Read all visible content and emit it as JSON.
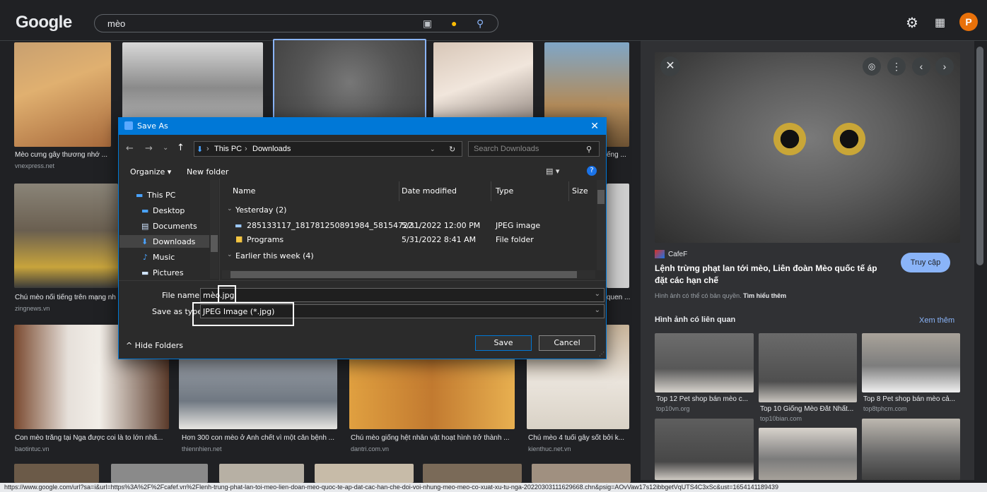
{
  "header": {
    "logo": "Google",
    "query": "mèo",
    "icons": [
      "camera-icon",
      "mic-icon",
      "search-icon",
      "settings-icon",
      "apps-icon"
    ],
    "avatar_letter": "P"
  },
  "results": [
    {
      "caption": "Mèo cưng gây thương nhớ ...",
      "source": "vnexpress.net"
    },
    {
      "caption": "ếng ...",
      "source": ""
    },
    {
      "caption": "Chú mèo nổi tiếng trên mạng nh",
      "source": "zingnews.vn"
    },
    {
      "caption": "quen ...",
      "source": ""
    },
    {
      "caption": "Con mèo trắng tại Nga được coi là to lớn nhấ...",
      "source": "baotintuc.vn"
    },
    {
      "caption": "Hơn 300 con mèo ở Anh chết vì một căn bệnh ...",
      "source": "thiennhien.net"
    },
    {
      "caption": "Chú mèo giống hệt nhân vật hoạt hình trở thành ...",
      "source": "dantri.com.vn"
    },
    {
      "caption": "Chú mèo 4 tuổi gây sốt bởi k...",
      "source": "kienthuc.net.vn"
    }
  ],
  "panel": {
    "site": "CafeF",
    "title": "Lệnh trừng phạt lan tới mèo, Liên đoàn Mèo quốc tế áp đặt các hạn chế",
    "visit_label": "Truy cập",
    "copyright": "Hình ảnh có thể có bản quyền.",
    "learn_more": "Tìm hiểu thêm",
    "related_title": "Hình ảnh có liên quan",
    "see_more": "Xem thêm",
    "related": [
      {
        "caption": "Top 12 Pet shop bán mèo c...",
        "source": "top10vn.org"
      },
      {
        "caption": "Top 10 Giống Mèo Đắt Nhất...",
        "source": "top10bian.com"
      },
      {
        "caption": "Top 8 Pet shop bán mèo cả...",
        "source": "top8tphcm.com"
      }
    ]
  },
  "dialog": {
    "title": "Save As",
    "path": [
      "This PC",
      "Downloads"
    ],
    "search_placeholder": "Search Downloads",
    "organize": "Organize ▾",
    "new_folder": "New folder",
    "nav": [
      "This PC",
      "Desktop",
      "Documents",
      "Downloads",
      "Music",
      "Pictures"
    ],
    "columns": [
      "Name",
      "Date modified",
      "Type",
      "Size"
    ],
    "groups": [
      "Yesterday (2)",
      "Earlier this week (4)"
    ],
    "files": [
      {
        "name": "285133117_181781250891984_58154722...",
        "date": "5/31/2022 12:00 PM",
        "type": "JPEG image"
      },
      {
        "name": "Programs",
        "date": "5/31/2022 8:41 AM",
        "type": "File folder"
      }
    ],
    "file_name_label": "File name:",
    "file_name_value": "mèo.jpg",
    "save_type_label": "Save as type:",
    "save_type_value": "JPEG Image (*.jpg)",
    "hide_folders": "Hide Folders",
    "save_label": "Save",
    "cancel_label": "Cancel"
  },
  "status_url": "https://www.google.com/url?sa=i&url=https%3A%2F%2Fcafef.vn%2Flenh-trung-phat-lan-toi-meo-lien-doan-meo-quoc-te-ap-dat-cac-han-che-doi-voi-nhung-meo-meo-co-xuat-xu-tu-nga-20220303111629668.chn&psig=AOvVaw17s12ibbgetVqUTS4C3xSc&ust=1654141189439"
}
